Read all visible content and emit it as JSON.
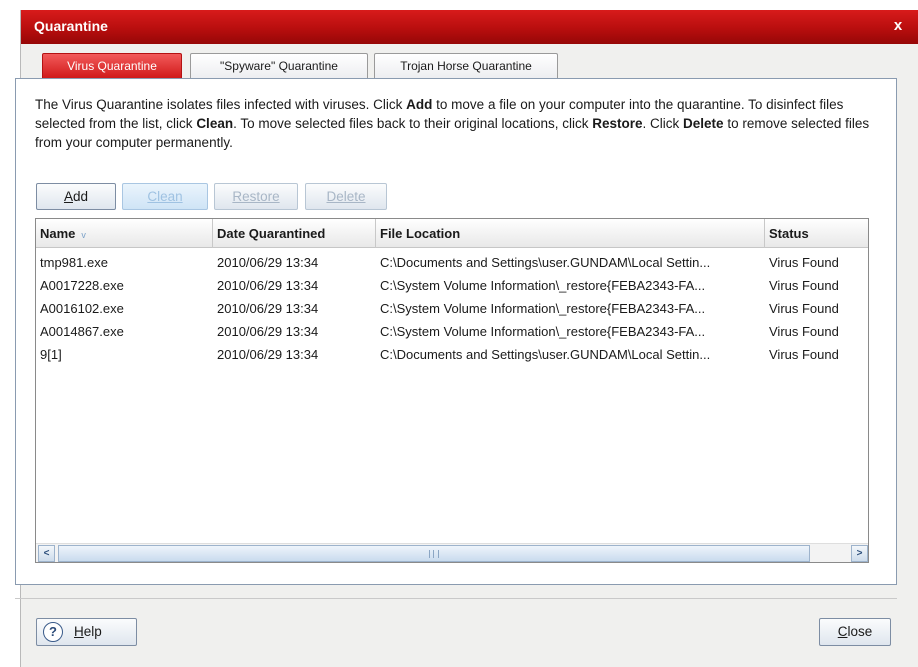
{
  "window": {
    "title": "Quarantine",
    "close_glyph": "x"
  },
  "tabs": [
    {
      "label": "Virus Quarantine",
      "active": true
    },
    {
      "label": "\"Spyware\" Quarantine",
      "active": false
    },
    {
      "label": "Trojan Horse Quarantine",
      "active": false
    }
  ],
  "description": {
    "p1": "The Virus Quarantine isolates files infected with viruses. Click ",
    "b1": "Add",
    "p2": " to move a file on your computer into the quarantine. To disinfect files selected from the list, click ",
    "b2": "Clean",
    "p3": ". To move selected files back to their original locations, click ",
    "b3": "Restore",
    "p4": ". Click ",
    "b4": "Delete",
    "p5": " to remove selected files from your computer permanently."
  },
  "toolbar": {
    "add": {
      "label_ul": "A",
      "label_rest": "dd"
    },
    "clean": {
      "label": "Clean"
    },
    "restore": {
      "label": "Restore"
    },
    "delete": {
      "label": "Delete"
    }
  },
  "table": {
    "columns": [
      "Name",
      "Date Quarantined",
      "File Location",
      "Status"
    ],
    "sort_indicator": "v",
    "rows": [
      {
        "name": "tmp981.exe",
        "date": "2010/06/29 13:34",
        "location": "C:\\Documents and Settings\\user.GUNDAM\\Local Settin...",
        "status": "Virus Found"
      },
      {
        "name": "A0017228.exe",
        "date": "2010/06/29 13:34",
        "location": "C:\\System Volume Information\\_restore{FEBA2343-FA...",
        "status": "Virus Found"
      },
      {
        "name": "A0016102.exe",
        "date": "2010/06/29 13:34",
        "location": "C:\\System Volume Information\\_restore{FEBA2343-FA...",
        "status": "Virus Found"
      },
      {
        "name": "A0014867.exe",
        "date": "2010/06/29 13:34",
        "location": "C:\\System Volume Information\\_restore{FEBA2343-FA...",
        "status": "Virus Found"
      },
      {
        "name": "9[1]",
        "date": "2010/06/29 13:34",
        "location": "C:\\Documents and Settings\\user.GUNDAM\\Local Settin...",
        "status": "Virus Found"
      }
    ]
  },
  "footer": {
    "help": {
      "icon": "help-circle-icon",
      "label_ul": "H",
      "label_rest": "elp"
    },
    "close": {
      "label_ul": "C",
      "label_rest": "lose"
    }
  },
  "colors": {
    "title_bar": "#c41414",
    "active_tab": "#e03030",
    "disabled_text": "#a8b6c6"
  }
}
